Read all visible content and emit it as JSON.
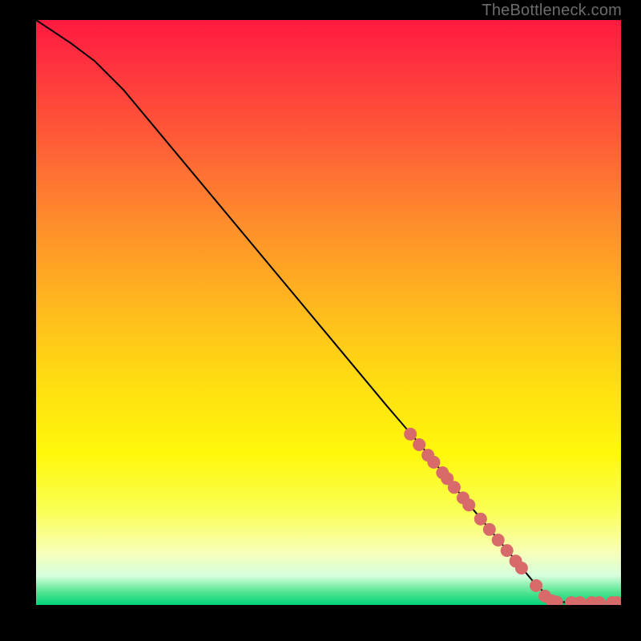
{
  "branding": "TheBottleneck.com",
  "chart_data": {
    "type": "line",
    "title": "",
    "xlabel": "",
    "ylabel": "",
    "xlim": [
      0,
      100
    ],
    "ylim": [
      0,
      100
    ],
    "series": [
      {
        "name": "curve",
        "x": [
          0,
          3,
          6,
          10,
          15,
          20,
          30,
          40,
          50,
          60,
          66,
          70,
          75,
          80,
          85,
          88,
          90,
          92,
          94,
          96,
          98,
          100
        ],
        "y": [
          100,
          98,
          96,
          93,
          88,
          82,
          70,
          58,
          46,
          34,
          27,
          22,
          16,
          10,
          4,
          1,
          0.5,
          0.4,
          0.4,
          0.4,
          0.4,
          0.4
        ]
      }
    ],
    "highlight_points": {
      "name": "dots",
      "color": "#d86a6a",
      "x": [
        64,
        65.5,
        67,
        68,
        69.5,
        70.3,
        71.5,
        73,
        74,
        76,
        77.5,
        79,
        80.5,
        82,
        83,
        85.5,
        87,
        88.2,
        89,
        91.5,
        93,
        95,
        96.3,
        98.5,
        99.3
      ],
      "y": [
        29.2,
        27.4,
        25.6,
        24.4,
        22.6,
        21.6,
        20.1,
        18.3,
        17.1,
        14.7,
        12.9,
        11.1,
        9.3,
        7.5,
        6.3,
        3.3,
        1.5,
        0.7,
        0.5,
        0.4,
        0.4,
        0.4,
        0.4,
        0.4,
        0.4
      ]
    },
    "gradient_stops": [
      {
        "pos": 0.0,
        "color": "#ff1a3f"
      },
      {
        "pos": 0.2,
        "color": "#ff5a38"
      },
      {
        "pos": 0.47,
        "color": "#ffb320"
      },
      {
        "pos": 0.74,
        "color": "#fff80a"
      },
      {
        "pos": 0.91,
        "color": "#f8ffb8"
      },
      {
        "pos": 0.98,
        "color": "#4be38c"
      },
      {
        "pos": 1.0,
        "color": "#00d37a"
      }
    ]
  }
}
